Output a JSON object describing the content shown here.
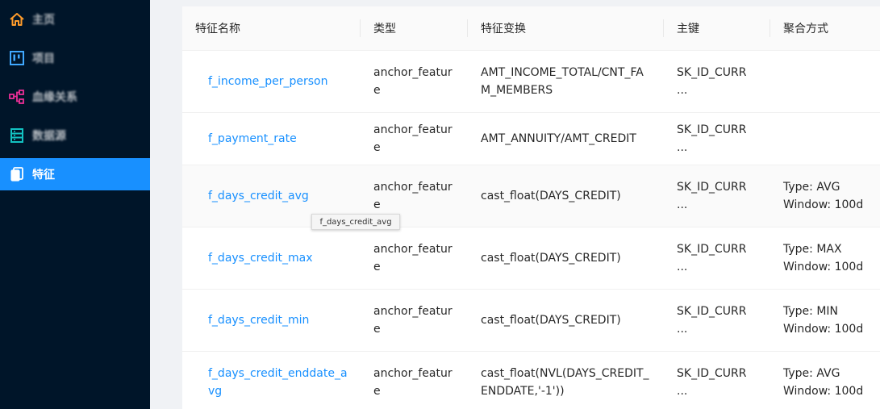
{
  "sidebar": {
    "items": [
      {
        "label": "主页",
        "icon": "home-icon",
        "active": false
      },
      {
        "label": "项目",
        "icon": "project-board-icon",
        "active": false
      },
      {
        "label": "血缘关系",
        "icon": "lineage-graph-icon",
        "active": false
      },
      {
        "label": "数据源",
        "icon": "datasource-icon",
        "active": false
      },
      {
        "label": "特征",
        "icon": "feature-copy-icon",
        "active": true
      }
    ]
  },
  "table": {
    "headers": [
      "特征名称",
      "类型",
      "特征变换",
      "主键",
      "聚合方式"
    ],
    "rows": [
      {
        "name": "f_income_per_person",
        "type": "anchor_feature",
        "transform": "AMT_INCOME_TOTAL/CNT_FAM_MEMBERS",
        "key": "SK_ID_CURR ...",
        "agg_type": "",
        "agg_window": ""
      },
      {
        "name": "f_payment_rate",
        "type": "anchor_feature",
        "transform": "AMT_ANNUITY/AMT_CREDIT",
        "key": "SK_ID_CURR ...",
        "agg_type": "",
        "agg_window": ""
      },
      {
        "name": "f_days_credit_avg",
        "type": "anchor_feature",
        "transform": "cast_float(DAYS_CREDIT)",
        "key": "SK_ID_CURR ...",
        "agg_type": "Type: AVG",
        "agg_window": "Window: 100d"
      },
      {
        "name": "f_days_credit_max",
        "type": "anchor_feature",
        "transform": "cast_float(DAYS_CREDIT)",
        "key": "SK_ID_CURR ...",
        "agg_type": "Type: MAX",
        "agg_window": "Window: 100d"
      },
      {
        "name": "f_days_credit_min",
        "type": "anchor_feature",
        "transform": "cast_float(DAYS_CREDIT)",
        "key": "SK_ID_CURR ...",
        "agg_type": "Type: MIN",
        "agg_window": "Window: 100d"
      },
      {
        "name": "f_days_credit_enddate_avg",
        "type": "anchor_feature",
        "transform": "cast_float(NVL(DAYS_CREDIT_ENDDATE,'-1'))",
        "key": "SK_ID_CURR ...",
        "agg_type": "Type: AVG",
        "agg_window": "Window: 100d"
      }
    ]
  },
  "tooltip": {
    "text": "f_days_credit_avg"
  },
  "colors": {
    "sidebar_bg": "#001529",
    "active_bg": "#1890ff",
    "link": "#1890ff",
    "home_icon": "#ff9c2b",
    "project_icon": "#40a9ff",
    "lineage_icon": "#eb2f96",
    "datasource_icon": "#13c2c2",
    "feature_icon": "#ffffff"
  }
}
